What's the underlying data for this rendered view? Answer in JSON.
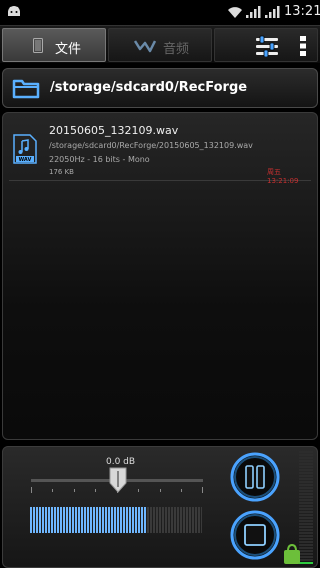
{
  "status_bar": {
    "time": "13:21",
    "icons": [
      "android-icon",
      "wifi-icon",
      "signal-icon",
      "signal-icon"
    ]
  },
  "tabs": [
    {
      "label": "文件",
      "icon": "file-icon",
      "active": true
    },
    {
      "label": "音频",
      "icon": "waveform-icon",
      "active": false
    }
  ],
  "toolbar": {
    "equalizer_icon": "equalizer-icon",
    "overflow_icon": "overflow-menu-icon"
  },
  "path_bar": {
    "icon": "folder-icon",
    "path": "/storage/sdcard0/RecForge"
  },
  "files": [
    {
      "name": "20150605_132109.wav",
      "path": "/storage/sdcard0/RecForge/20150605_132109.wav",
      "info": "22050Hz - 16 bits - Mono",
      "size": "176 KB",
      "date": "周五 13:21:09",
      "icon": "wav-file-icon"
    }
  ],
  "controls": {
    "gain_label": "0.0 dB",
    "gain_level": 0.5,
    "input_level": 0.67,
    "vu_level": 0.05,
    "pause_icon": "pause-icon",
    "stop_icon": "stop-icon"
  },
  "colors": {
    "accent_blue": "#4aa3ff",
    "meter_blue": "#6fb7ff",
    "date_red": "#c83030",
    "vu_green": "#2ecc40"
  }
}
